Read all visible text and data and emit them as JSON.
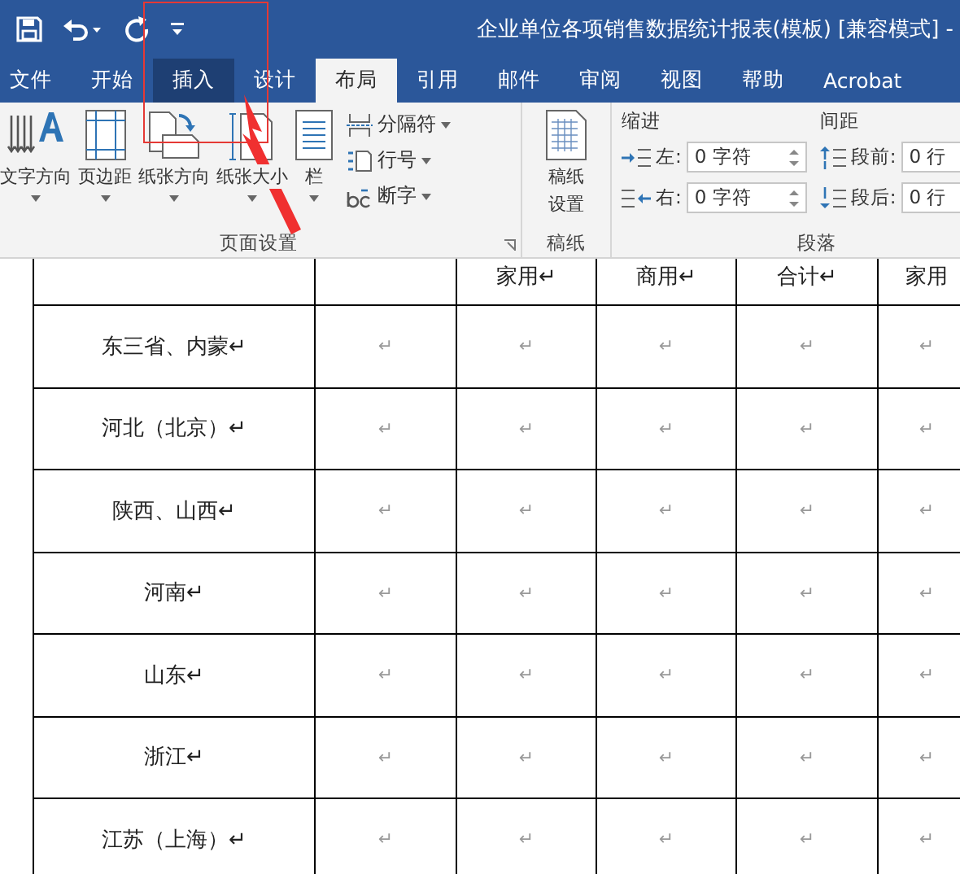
{
  "window": {
    "title": "企业单位各项销售数据统计报表(模板) [兼容模式] -"
  },
  "tabs": [
    {
      "label": "文件",
      "selected": false,
      "hover": false
    },
    {
      "label": "开始",
      "selected": false,
      "hover": false
    },
    {
      "label": "插入",
      "selected": false,
      "hover": true
    },
    {
      "label": "设计",
      "selected": false,
      "hover": false
    },
    {
      "label": "布局",
      "selected": true,
      "hover": false
    },
    {
      "label": "引用",
      "selected": false,
      "hover": false
    },
    {
      "label": "邮件",
      "selected": false,
      "hover": false
    },
    {
      "label": "审阅",
      "selected": false,
      "hover": false
    },
    {
      "label": "视图",
      "selected": false,
      "hover": false
    },
    {
      "label": "帮助",
      "selected": false,
      "hover": false
    },
    {
      "label": "Acrobat",
      "selected": false,
      "hover": false
    }
  ],
  "page_setup": {
    "label": "页面设置",
    "large_buttons": [
      {
        "kind": "text-direction",
        "label": "文字方向"
      },
      {
        "kind": "margins",
        "label": "页边距"
      },
      {
        "kind": "orientation",
        "label": "纸张方向"
      },
      {
        "kind": "size",
        "label": "纸张大小"
      },
      {
        "kind": "columns",
        "label": "栏"
      }
    ],
    "small_buttons": [
      {
        "kind": "breaks",
        "label": "分隔符"
      },
      {
        "kind": "line-numbers",
        "label": "行号"
      },
      {
        "kind": "hyphenation",
        "label": "断字"
      }
    ]
  },
  "manuscript": {
    "label": "稿纸",
    "button": [
      "稿纸",
      "设置"
    ]
  },
  "paragraph": {
    "label": "段落",
    "indent": {
      "title": "缩进",
      "fields": [
        {
          "kind": "left",
          "label": "左:",
          "value": "0 字符"
        },
        {
          "kind": "right",
          "label": "右:",
          "value": "0 字符"
        }
      ]
    },
    "spacing": {
      "title": "间距",
      "fields": [
        {
          "kind": "before",
          "label": "段前:",
          "value": "0 行"
        },
        {
          "kind": "after",
          "label": "段后:",
          "value": "0 行"
        }
      ]
    }
  },
  "table": {
    "header": [
      "家用↵",
      "商用↵",
      "合计↵",
      "家用"
    ],
    "rows": [
      {
        "region": "东三省、内蒙↵",
        "cells": [
          "↵",
          "↵",
          "↵",
          "↵",
          "↵"
        ]
      },
      {
        "region": "河北（北京）↵",
        "cells": [
          "↵",
          "↵",
          "↵",
          "↵",
          "↵"
        ]
      },
      {
        "region": "陕西、山西↵",
        "cells": [
          "↵",
          "↵",
          "↵",
          "↵",
          "↵"
        ]
      },
      {
        "region": "河南↵",
        "cells": [
          "↵",
          "↵",
          "↵",
          "↵",
          "↵"
        ]
      },
      {
        "region": "山东↵",
        "cells": [
          "↵",
          "↵",
          "↵",
          "↵",
          "↵"
        ]
      },
      {
        "region": "浙江↵",
        "cells": [
          "↵",
          "↵",
          "↵",
          "↵",
          "↵"
        ]
      },
      {
        "region": "江苏（上海）↵",
        "cells": [
          "↵",
          "↵",
          "↵",
          "↵",
          "↵"
        ]
      }
    ]
  }
}
